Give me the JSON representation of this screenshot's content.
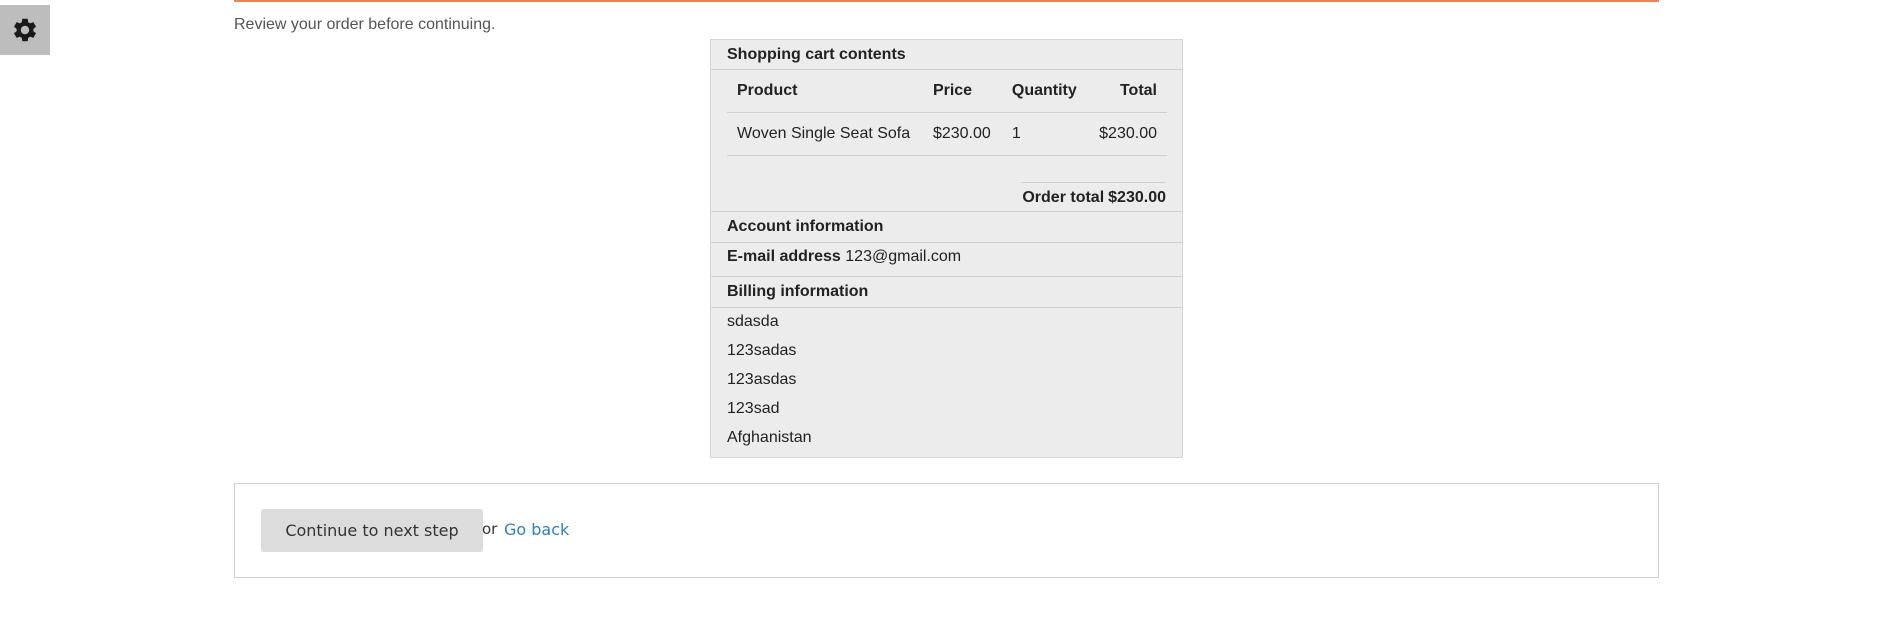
{
  "settings": {
    "icon": "gear-icon",
    "color": "#1a1a1a"
  },
  "intro_text": "Review your order before continuing.",
  "cart": {
    "title": "Shopping cart contents",
    "headers": {
      "product": "Product",
      "price": "Price",
      "quantity": "Quantity",
      "total": "Total"
    },
    "rows": [
      {
        "product": "Woven Single Seat Sofa",
        "price": "$230.00",
        "quantity": "1",
        "total": "$230.00"
      }
    ],
    "order_total_label": "Order total",
    "order_total_value": "$230.00"
  },
  "account": {
    "title": "Account information",
    "email_label": "E-mail address",
    "email_value": "123@gmail.com"
  },
  "billing": {
    "title": "Billing information",
    "lines": [
      "sdasda",
      "123sadas",
      "123asdas",
      "123sad",
      "Afghanistan"
    ]
  },
  "actions": {
    "continue_label": "Continue to next step",
    "or_text": "or",
    "go_back_label": "Go back"
  },
  "colors": {
    "accent_border": "#e8845a",
    "link": "#2f7fc1",
    "panel_bg": "#ececec"
  }
}
